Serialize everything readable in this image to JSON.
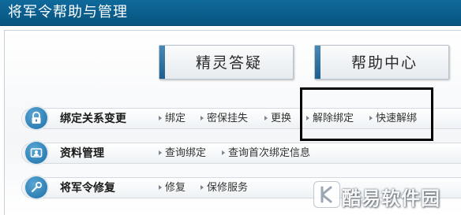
{
  "window": {
    "title": "将军令帮助与管理"
  },
  "top_buttons": [
    {
      "label": "精灵答疑"
    },
    {
      "label": "帮助中心"
    }
  ],
  "rows": [
    {
      "icon": "lock-icon",
      "title": "绑定关系变更",
      "links": [
        "绑定",
        "密保挂失",
        "更换",
        "解除绑定",
        "快速解绑"
      ]
    },
    {
      "icon": "profile-card-icon",
      "title": "资料管理",
      "links": [
        "查询绑定",
        "查询首次绑定信息"
      ]
    },
    {
      "icon": "repair-icon",
      "title": "将军令修复",
      "links": [
        "修复",
        "保修服务"
      ]
    }
  ],
  "watermark": {
    "text": "酷易软件园",
    "logo_letter": "K"
  },
  "colors": {
    "titlebar": "#07547f",
    "accent": "#1c6ea5",
    "highlight_box": "#000000"
  }
}
